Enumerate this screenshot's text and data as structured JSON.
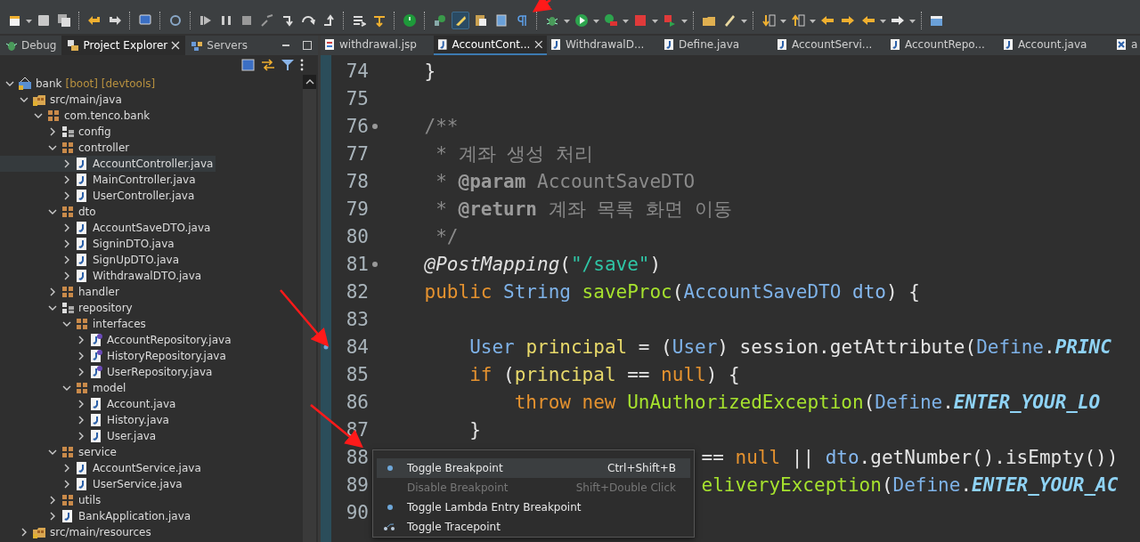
{
  "side_tabs": [
    {
      "label": "Debug",
      "selected": false,
      "kind": "debug"
    },
    {
      "label": "Project Explorer",
      "selected": true,
      "kind": "explorer"
    },
    {
      "label": "Servers",
      "selected": false,
      "kind": "servers"
    }
  ],
  "tree": [
    {
      "label": "bank",
      "decoration": "[boot] [devtools]",
      "kind": "project",
      "expanded": true,
      "selected": false,
      "children": [
        {
          "label": "src/main/java",
          "kind": "srcfolder",
          "expanded": true,
          "selected": false,
          "children": [
            {
              "label": "com.tenco.bank",
              "kind": "package",
              "expanded": true,
              "selected": false,
              "children": [
                {
                  "label": "config",
                  "kind": "pkgtree",
                  "expanded": false,
                  "selected": false
                },
                {
                  "label": "controller",
                  "kind": "package",
                  "expanded": true,
                  "selected": false,
                  "children": [
                    {
                      "label": "AccountController.java",
                      "kind": "java",
                      "expanded": false,
                      "selected": true
                    },
                    {
                      "label": "MainController.java",
                      "kind": "java",
                      "expanded": false,
                      "selected": false
                    },
                    {
                      "label": "UserController.java",
                      "kind": "java",
                      "expanded": false,
                      "selected": false
                    }
                  ]
                },
                {
                  "label": "dto",
                  "kind": "package",
                  "expanded": true,
                  "selected": false,
                  "children": [
                    {
                      "label": "AccountSaveDTO.java",
                      "kind": "java",
                      "expanded": false,
                      "selected": false
                    },
                    {
                      "label": "SigninDTO.java",
                      "kind": "java",
                      "expanded": false,
                      "selected": false
                    },
                    {
                      "label": "SignUpDTO.java",
                      "kind": "java",
                      "expanded": false,
                      "selected": false
                    },
                    {
                      "label": "WithdrawalDTO.java",
                      "kind": "java",
                      "expanded": false,
                      "selected": false
                    }
                  ]
                },
                {
                  "label": "handler",
                  "kind": "package",
                  "expanded": false,
                  "selected": false
                },
                {
                  "label": "repository",
                  "kind": "pkgtree",
                  "expanded": true,
                  "selected": false,
                  "children": [
                    {
                      "label": "interfaces",
                      "kind": "package",
                      "expanded": true,
                      "selected": false,
                      "children": [
                        {
                          "label": "AccountRepository.java",
                          "kind": "interface",
                          "expanded": false,
                          "selected": false
                        },
                        {
                          "label": "HistoryRepository.java",
                          "kind": "interface",
                          "expanded": false,
                          "selected": false
                        },
                        {
                          "label": "UserRepository.java",
                          "kind": "interface",
                          "expanded": false,
                          "selected": false
                        }
                      ]
                    },
                    {
                      "label": "model",
                      "kind": "package",
                      "expanded": true,
                      "selected": false,
                      "children": [
                        {
                          "label": "Account.java",
                          "kind": "java",
                          "expanded": false,
                          "selected": false
                        },
                        {
                          "label": "History.java",
                          "kind": "java",
                          "expanded": false,
                          "selected": false
                        },
                        {
                          "label": "User.java",
                          "kind": "java",
                          "expanded": false,
                          "selected": false
                        }
                      ]
                    }
                  ]
                },
                {
                  "label": "service",
                  "kind": "package",
                  "expanded": true,
                  "selected": false,
                  "children": [
                    {
                      "label": "AccountService.java",
                      "kind": "java",
                      "expanded": false,
                      "selected": false
                    },
                    {
                      "label": "UserService.java",
                      "kind": "java",
                      "expanded": false,
                      "selected": false
                    }
                  ]
                },
                {
                  "label": "utils",
                  "kind": "package",
                  "expanded": false,
                  "selected": false
                },
                {
                  "label": "BankApplication.java",
                  "kind": "java",
                  "expanded": false,
                  "selected": false
                }
              ]
            }
          ]
        },
        {
          "label": "src/main/resources",
          "kind": "srcfolder",
          "expanded": false,
          "selected": false
        }
      ]
    }
  ],
  "editor_tabs": [
    {
      "label": "withdrawal.jsp",
      "kind": "jsp",
      "selected": false
    },
    {
      "label": "AccountCont...",
      "kind": "java",
      "selected": true
    },
    {
      "label": "WithdrawalD...",
      "kind": "java",
      "selected": false
    },
    {
      "label": "Define.java",
      "kind": "java",
      "selected": false
    },
    {
      "label": "AccountServi...",
      "kind": "java",
      "selected": false
    },
    {
      "label": "AccountRepo...",
      "kind": "java",
      "selected": false
    },
    {
      "label": "Account.java",
      "kind": "java",
      "selected": false
    },
    {
      "label": "a",
      "kind": "xml",
      "selected": false
    }
  ],
  "code_lines": [
    {
      "number": "74",
      "fold": false,
      "breakpoint": false,
      "tokens": [
        {
          "text": "    }",
          "kind": "plain"
        }
      ]
    },
    {
      "number": "75",
      "fold": false,
      "breakpoint": false
    },
    {
      "number": "76",
      "fold": true,
      "breakpoint": false,
      "tokens": [
        {
          "text": "    /**",
          "kind": "comment"
        }
      ]
    },
    {
      "number": "77",
      "fold": false,
      "breakpoint": false,
      "tokens": [
        {
          "text": "     * 계좌 생성 처리",
          "kind": "comment"
        }
      ]
    },
    {
      "number": "78",
      "fold": false,
      "breakpoint": false,
      "tokens": [
        {
          "text": "     * ",
          "kind": "comment"
        },
        {
          "text": "@param",
          "kind": "doctag"
        },
        {
          "text": " AccountSaveDTO",
          "kind": "comment"
        }
      ]
    },
    {
      "number": "79",
      "fold": false,
      "breakpoint": false,
      "tokens": [
        {
          "text": "     * ",
          "kind": "comment"
        },
        {
          "text": "@return",
          "kind": "doctag"
        },
        {
          "text": " 계좌 목록 화면 이동",
          "kind": "comment"
        }
      ]
    },
    {
      "number": "80",
      "fold": false,
      "breakpoint": false,
      "tokens": [
        {
          "text": "     */",
          "kind": "comment"
        }
      ]
    },
    {
      "number": "81",
      "fold": true,
      "breakpoint": false,
      "tokens": [
        {
          "text": "    @PostMapping",
          "kind": "ann"
        },
        {
          "text": "(",
          "kind": "plain"
        },
        {
          "text": "\"/save\"",
          "kind": "str"
        },
        {
          "text": ")",
          "kind": "plain"
        }
      ]
    },
    {
      "number": "82",
      "fold": false,
      "breakpoint": false,
      "tokens": [
        {
          "text": "    public ",
          "kind": "kw"
        },
        {
          "text": "String ",
          "kind": "type"
        },
        {
          "text": "saveProc",
          "kind": "fn"
        },
        {
          "text": "(",
          "kind": "plain"
        },
        {
          "text": "AccountSaveDTO ",
          "kind": "type"
        },
        {
          "text": "dto",
          "kind": "var"
        },
        {
          "text": ") {",
          "kind": "plain"
        }
      ]
    },
    {
      "number": "83",
      "fold": false,
      "breakpoint": false
    },
    {
      "number": "84",
      "fold": false,
      "breakpoint": true,
      "tokens": [
        {
          "text": "        User ",
          "kind": "type"
        },
        {
          "text": "principal",
          "kind": "local"
        },
        {
          "text": " = (",
          "kind": "plain"
        },
        {
          "text": "User",
          "kind": "type"
        },
        {
          "text": ") session.getAttribute(",
          "kind": "plain"
        },
        {
          "text": "Define",
          "kind": "type"
        },
        {
          "text": ".",
          "kind": "plain"
        },
        {
          "text": "PRINC",
          "kind": "const"
        }
      ]
    },
    {
      "number": "85",
      "fold": false,
      "breakpoint": false,
      "tokens": [
        {
          "text": "        if",
          "kind": "kw"
        },
        {
          "text": " (",
          "kind": "plain"
        },
        {
          "text": "principal",
          "kind": "local"
        },
        {
          "text": " == ",
          "kind": "plain"
        },
        {
          "text": "null",
          "kind": "kw"
        },
        {
          "text": ") {",
          "kind": "plain"
        }
      ]
    },
    {
      "number": "86",
      "fold": false,
      "breakpoint": false,
      "tokens": [
        {
          "text": "            throw new ",
          "kind": "kw"
        },
        {
          "text": "UnAuthorizedException",
          "kind": "fn"
        },
        {
          "text": "(",
          "kind": "plain"
        },
        {
          "text": "Define",
          "kind": "type"
        },
        {
          "text": ".",
          "kind": "plain"
        },
        {
          "text": "ENTER_YOUR_LO",
          "kind": "const"
        }
      ]
    },
    {
      "number": "87",
      "fold": false,
      "breakpoint": false,
      "tokens": [
        {
          "text": "        }",
          "kind": "plain"
        }
      ]
    }
  ],
  "lines_under_menu": [
    {
      "number": "88",
      "tokens": [
        {
          "text": "== ",
          "kind": "plain"
        },
        {
          "text": "null",
          "kind": "kw"
        },
        {
          "text": " || ",
          "kind": "plain"
        },
        {
          "text": "dto",
          "kind": "var"
        },
        {
          "text": ".getNumber().isEmpty())",
          "kind": "plain"
        }
      ]
    },
    {
      "number": "89",
      "tokens": [
        {
          "text": "eliveryException",
          "kind": "fn"
        },
        {
          "text": "(",
          "kind": "plain"
        },
        {
          "text": "Define",
          "kind": "type"
        },
        {
          "text": ".",
          "kind": "plain"
        },
        {
          "text": "ENTER_YOUR_AC",
          "kind": "const"
        }
      ]
    },
    {
      "number": "90"
    }
  ],
  "context_menu": [
    {
      "label": "Toggle Breakpoint",
      "shortcut": "Ctrl+Shift+B",
      "selected": true,
      "disabled": false
    },
    {
      "label": "Disable Breakpoint",
      "shortcut": "Shift+Double Click",
      "selected": false,
      "disabled": true
    },
    {
      "label": "Toggle Lambda Entry Breakpoint",
      "selected": false,
      "disabled": false
    },
    {
      "label": "Toggle Tracepoint",
      "selected": false,
      "disabled": false
    }
  ]
}
